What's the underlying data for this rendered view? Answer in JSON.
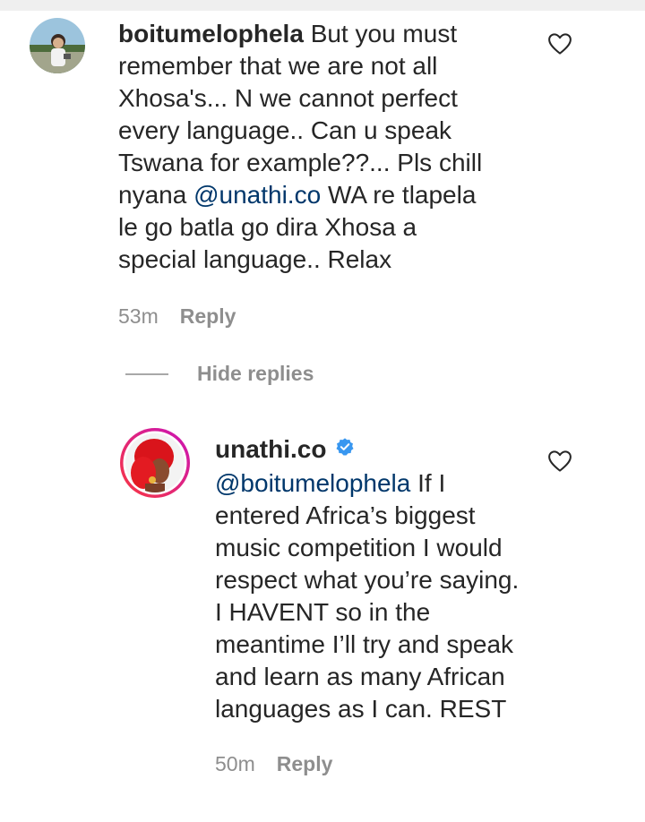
{
  "comments": [
    {
      "username": "boitumelophela",
      "text_before": "But you must remember that we are not all Xhosa's... N we cannot perfect every language.. Can u speak Tswana for example??... Pls chill nyana",
      "mention": "@unathi.co",
      "text_after": "WA re tlapela le go batla go dira Xhosa a special language.. Relax",
      "time": "53m",
      "reply_label": "Reply"
    }
  ],
  "thread": {
    "hide_replies_label": "Hide replies"
  },
  "replies": [
    {
      "username": "unathi.co",
      "verified": true,
      "mention": "@boitumelophela",
      "text_after": "If I entered Africa’s biggest music competition I would respect what you’re saying. I HAVENT so in the meantime I’ll try and speak and learn as many African languages as I can. REST",
      "time": "50m",
      "reply_label": "Reply"
    }
  ],
  "icons": {
    "like": "heart-outline-icon",
    "verified": "verified-badge-icon"
  },
  "colors": {
    "text": "#262626",
    "meta": "#8e8e8e",
    "mention": "#00376b",
    "verified": "#3897f0",
    "story_ring_start": "#c913b9",
    "story_ring_end": "#f9373f"
  }
}
